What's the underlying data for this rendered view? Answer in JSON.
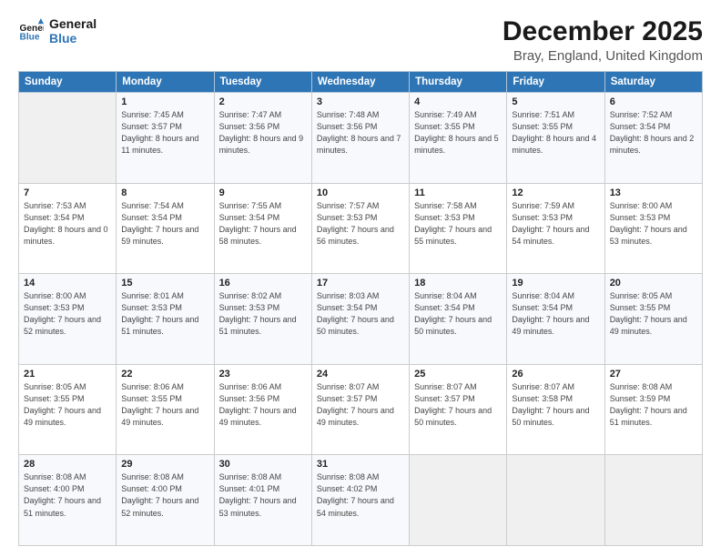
{
  "logo": {
    "line1": "General",
    "line2": "Blue"
  },
  "title": "December 2025",
  "subtitle": "Bray, England, United Kingdom",
  "days_header": [
    "Sunday",
    "Monday",
    "Tuesday",
    "Wednesday",
    "Thursday",
    "Friday",
    "Saturday"
  ],
  "weeks": [
    [
      {
        "day": "",
        "sunrise": "",
        "sunset": "",
        "daylight": ""
      },
      {
        "day": "1",
        "sunrise": "Sunrise: 7:45 AM",
        "sunset": "Sunset: 3:57 PM",
        "daylight": "Daylight: 8 hours and 11 minutes."
      },
      {
        "day": "2",
        "sunrise": "Sunrise: 7:47 AM",
        "sunset": "Sunset: 3:56 PM",
        "daylight": "Daylight: 8 hours and 9 minutes."
      },
      {
        "day": "3",
        "sunrise": "Sunrise: 7:48 AM",
        "sunset": "Sunset: 3:56 PM",
        "daylight": "Daylight: 8 hours and 7 minutes."
      },
      {
        "day": "4",
        "sunrise": "Sunrise: 7:49 AM",
        "sunset": "Sunset: 3:55 PM",
        "daylight": "Daylight: 8 hours and 5 minutes."
      },
      {
        "day": "5",
        "sunrise": "Sunrise: 7:51 AM",
        "sunset": "Sunset: 3:55 PM",
        "daylight": "Daylight: 8 hours and 4 minutes."
      },
      {
        "day": "6",
        "sunrise": "Sunrise: 7:52 AM",
        "sunset": "Sunset: 3:54 PM",
        "daylight": "Daylight: 8 hours and 2 minutes."
      }
    ],
    [
      {
        "day": "7",
        "sunrise": "Sunrise: 7:53 AM",
        "sunset": "Sunset: 3:54 PM",
        "daylight": "Daylight: 8 hours and 0 minutes."
      },
      {
        "day": "8",
        "sunrise": "Sunrise: 7:54 AM",
        "sunset": "Sunset: 3:54 PM",
        "daylight": "Daylight: 7 hours and 59 minutes."
      },
      {
        "day": "9",
        "sunrise": "Sunrise: 7:55 AM",
        "sunset": "Sunset: 3:54 PM",
        "daylight": "Daylight: 7 hours and 58 minutes."
      },
      {
        "day": "10",
        "sunrise": "Sunrise: 7:57 AM",
        "sunset": "Sunset: 3:53 PM",
        "daylight": "Daylight: 7 hours and 56 minutes."
      },
      {
        "day": "11",
        "sunrise": "Sunrise: 7:58 AM",
        "sunset": "Sunset: 3:53 PM",
        "daylight": "Daylight: 7 hours and 55 minutes."
      },
      {
        "day": "12",
        "sunrise": "Sunrise: 7:59 AM",
        "sunset": "Sunset: 3:53 PM",
        "daylight": "Daylight: 7 hours and 54 minutes."
      },
      {
        "day": "13",
        "sunrise": "Sunrise: 8:00 AM",
        "sunset": "Sunset: 3:53 PM",
        "daylight": "Daylight: 7 hours and 53 minutes."
      }
    ],
    [
      {
        "day": "14",
        "sunrise": "Sunrise: 8:00 AM",
        "sunset": "Sunset: 3:53 PM",
        "daylight": "Daylight: 7 hours and 52 minutes."
      },
      {
        "day": "15",
        "sunrise": "Sunrise: 8:01 AM",
        "sunset": "Sunset: 3:53 PM",
        "daylight": "Daylight: 7 hours and 51 minutes."
      },
      {
        "day": "16",
        "sunrise": "Sunrise: 8:02 AM",
        "sunset": "Sunset: 3:53 PM",
        "daylight": "Daylight: 7 hours and 51 minutes."
      },
      {
        "day": "17",
        "sunrise": "Sunrise: 8:03 AM",
        "sunset": "Sunset: 3:54 PM",
        "daylight": "Daylight: 7 hours and 50 minutes."
      },
      {
        "day": "18",
        "sunrise": "Sunrise: 8:04 AM",
        "sunset": "Sunset: 3:54 PM",
        "daylight": "Daylight: 7 hours and 50 minutes."
      },
      {
        "day": "19",
        "sunrise": "Sunrise: 8:04 AM",
        "sunset": "Sunset: 3:54 PM",
        "daylight": "Daylight: 7 hours and 49 minutes."
      },
      {
        "day": "20",
        "sunrise": "Sunrise: 8:05 AM",
        "sunset": "Sunset: 3:55 PM",
        "daylight": "Daylight: 7 hours and 49 minutes."
      }
    ],
    [
      {
        "day": "21",
        "sunrise": "Sunrise: 8:05 AM",
        "sunset": "Sunset: 3:55 PM",
        "daylight": "Daylight: 7 hours and 49 minutes."
      },
      {
        "day": "22",
        "sunrise": "Sunrise: 8:06 AM",
        "sunset": "Sunset: 3:55 PM",
        "daylight": "Daylight: 7 hours and 49 minutes."
      },
      {
        "day": "23",
        "sunrise": "Sunrise: 8:06 AM",
        "sunset": "Sunset: 3:56 PM",
        "daylight": "Daylight: 7 hours and 49 minutes."
      },
      {
        "day": "24",
        "sunrise": "Sunrise: 8:07 AM",
        "sunset": "Sunset: 3:57 PM",
        "daylight": "Daylight: 7 hours and 49 minutes."
      },
      {
        "day": "25",
        "sunrise": "Sunrise: 8:07 AM",
        "sunset": "Sunset: 3:57 PM",
        "daylight": "Daylight: 7 hours and 50 minutes."
      },
      {
        "day": "26",
        "sunrise": "Sunrise: 8:07 AM",
        "sunset": "Sunset: 3:58 PM",
        "daylight": "Daylight: 7 hours and 50 minutes."
      },
      {
        "day": "27",
        "sunrise": "Sunrise: 8:08 AM",
        "sunset": "Sunset: 3:59 PM",
        "daylight": "Daylight: 7 hours and 51 minutes."
      }
    ],
    [
      {
        "day": "28",
        "sunrise": "Sunrise: 8:08 AM",
        "sunset": "Sunset: 4:00 PM",
        "daylight": "Daylight: 7 hours and 51 minutes."
      },
      {
        "day": "29",
        "sunrise": "Sunrise: 8:08 AM",
        "sunset": "Sunset: 4:00 PM",
        "daylight": "Daylight: 7 hours and 52 minutes."
      },
      {
        "day": "30",
        "sunrise": "Sunrise: 8:08 AM",
        "sunset": "Sunset: 4:01 PM",
        "daylight": "Daylight: 7 hours and 53 minutes."
      },
      {
        "day": "31",
        "sunrise": "Sunrise: 8:08 AM",
        "sunset": "Sunset: 4:02 PM",
        "daylight": "Daylight: 7 hours and 54 minutes."
      },
      {
        "day": "",
        "sunrise": "",
        "sunset": "",
        "daylight": ""
      },
      {
        "day": "",
        "sunrise": "",
        "sunset": "",
        "daylight": ""
      },
      {
        "day": "",
        "sunrise": "",
        "sunset": "",
        "daylight": ""
      }
    ]
  ]
}
